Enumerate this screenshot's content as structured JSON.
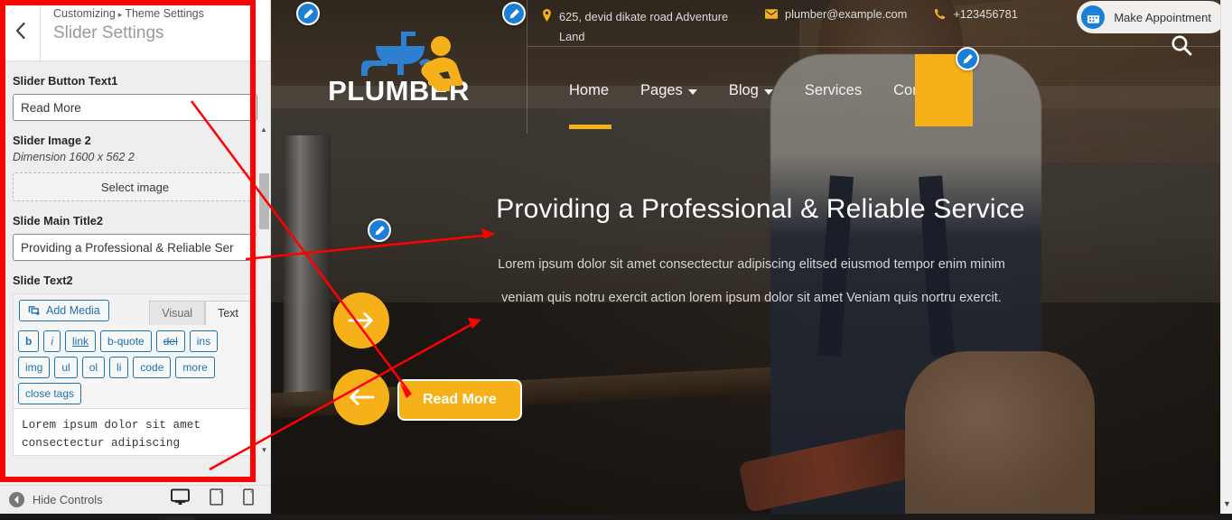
{
  "customizer": {
    "breadcrumb_prefix": "Customizing",
    "breadcrumb_sep": "▸",
    "breadcrumb_section": "Theme Settings",
    "panel_title": "Slider Settings",
    "back_icon": "‹",
    "controls": {
      "button_text_label": "Slider Button Text1",
      "button_text_value": "Read More",
      "slider_image_label": "Slider Image 2",
      "slider_image_desc": "Dimension 1600 x 562 2",
      "select_image_label": "Select image",
      "main_title_label": "Slide Main Title2",
      "main_title_value": "Providing a Professional & Reliable Ser",
      "slide_text_label": "Slide Text2"
    },
    "editor": {
      "add_media_label": "Add Media",
      "tabs": [
        {
          "label": "Visual",
          "active": false
        },
        {
          "label": "Text",
          "active": true
        }
      ],
      "quicktags": [
        "b",
        "i",
        "link",
        "b-quote",
        "del",
        "ins",
        "img",
        "ul",
        "ol",
        "li",
        "code",
        "more",
        "close tags"
      ],
      "content": "Lorem ipsum dolor sit amet consectectur adipiscing"
    },
    "footer": {
      "hide_controls_label": "Hide Controls",
      "devices": [
        {
          "name": "desktop",
          "active": true
        },
        {
          "name": "tablet",
          "active": false
        },
        {
          "name": "mobile",
          "active": false
        }
      ]
    }
  },
  "preview": {
    "topbar": {
      "address": "625, devid dikate road Adventure Land",
      "email": "plumber@example.com",
      "phone": "+123456781",
      "appointment_label": "Make Appointment"
    },
    "logo_text": "PLUMBER",
    "nav": [
      {
        "label": "Home",
        "active": true,
        "caret": false
      },
      {
        "label": "Pages",
        "active": false,
        "caret": true
      },
      {
        "label": "Blog",
        "active": false,
        "caret": true
      },
      {
        "label": "Services",
        "active": false,
        "caret": false
      },
      {
        "label": "Contact Us",
        "active": false,
        "caret": false
      }
    ],
    "hero": {
      "title": "Providing a Professional & Reliable Service",
      "text_line1": "Lorem ipsum dolor sit amet consectectur adipiscing elitsed eiusmod tempor enim minim",
      "text_line2": "veniam quis notru exercit action lorem ipsum dolor sit amet Veniam quis nortru exercit.",
      "button_label": "Read More"
    }
  },
  "colors": {
    "accent_yellow": "#f5b01a",
    "edit_blue": "#1c7fd6",
    "annotation_red": "#ff0000",
    "wp_link_blue": "#2271b1"
  }
}
